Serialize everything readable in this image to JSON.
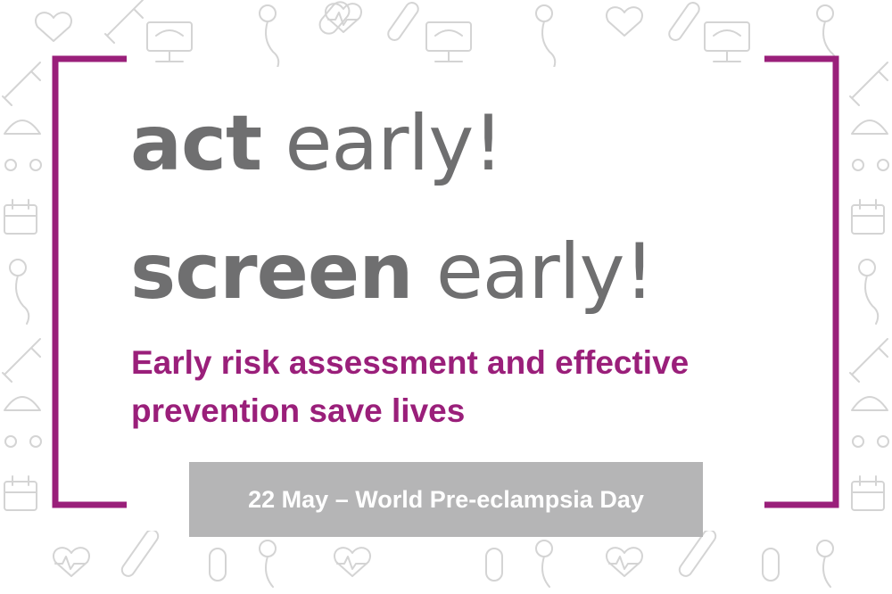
{
  "headline": {
    "line1_bold": "act",
    "line1_light": "early!",
    "line2_bold": "screen",
    "line2_light": "early!"
  },
  "subheadline": {
    "line1": "Early risk assessment and effective",
    "line2": "prevention save lives"
  },
  "date_bar": {
    "text": "22 May – World Pre-eclampsia Day"
  },
  "colors": {
    "bracket": "#9a1f7a",
    "headline": "#6f6f70",
    "subheadline": "#9a1f7a",
    "date_bar_bg": "#b5b5b6",
    "pattern": "#d4d4d4"
  },
  "background_icons": [
    "heart-icon",
    "ultrasound-machine-icon",
    "syringe-icon",
    "thermometer-icon",
    "pregnant-woman-icon",
    "baby-stroller-icon",
    "pill-icon",
    "calendar-icon",
    "ecg-heartbeat-icon"
  ]
}
